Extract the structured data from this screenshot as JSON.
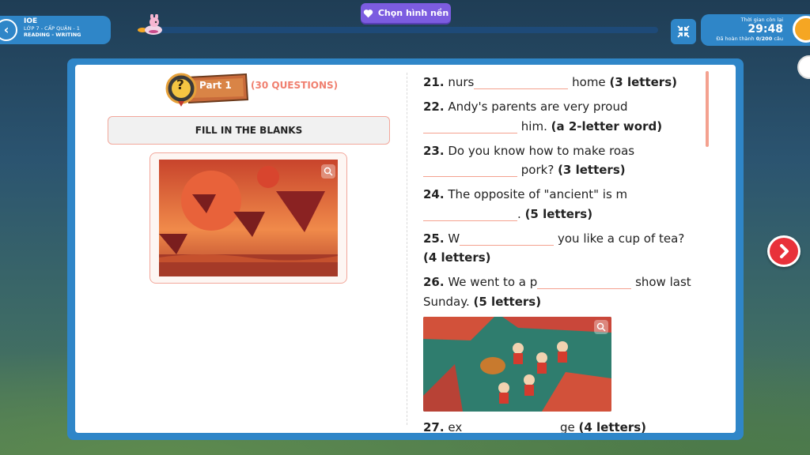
{
  "header": {
    "app_name": "IOE",
    "grade_level": "LỚP 7 - CẤP QUẬN - 1",
    "section": "READING - WRITING",
    "background_button_label": "Chọn hình nền",
    "progress_percent": 0,
    "timer_label": "Thời gian còn lại",
    "timer_value": "29:48",
    "completed_label": "Đã hoàn thành",
    "completed_value": "0/200",
    "completed_unit": "câu"
  },
  "part": {
    "label": "Part 1",
    "question_count": "(30 QUESTIONS)",
    "instruction": "FILL IN THE BLANKS"
  },
  "questions": [
    {
      "num": "21.",
      "before": "nurs",
      "after": "home",
      "hint": "(3 letters)"
    },
    {
      "num": "22.",
      "before": "Andy's parents are very proud",
      "after": "him.",
      "hint": "(a 2-letter word)"
    },
    {
      "num": "23.",
      "before": "Do you know how to make roas",
      "after": "pork?",
      "hint": "(3 letters)"
    },
    {
      "num": "24.",
      "before": "The opposite of \"ancient\" is m",
      "after": ".",
      "hint": "(5 letters)"
    },
    {
      "num": "25.",
      "before": "W",
      "after": "you like a cup of tea?",
      "hint": "(4 letters)"
    },
    {
      "num": "26.",
      "before": "We went to a p",
      "after": "show last Sunday.",
      "hint": "(5 letters)"
    },
    {
      "num": "27.",
      "before": "ex",
      "after": "ge",
      "hint": "(4 letters)"
    }
  ],
  "icons": {
    "back": "chevron-left-icon",
    "heart": "heart-icon",
    "collapse": "collapse-arrows-icon",
    "clock": "clock-icon",
    "zoom": "zoom-in-icon",
    "next": "chevron-right-icon",
    "question": "question-mark-icon"
  },
  "colors": {
    "primary_blue": "#2f86c8",
    "accent_orange": "#f26a3c",
    "blank_line": "#f4a18f",
    "next_red": "#e8313a",
    "purple_button": "#7c5ce0"
  }
}
